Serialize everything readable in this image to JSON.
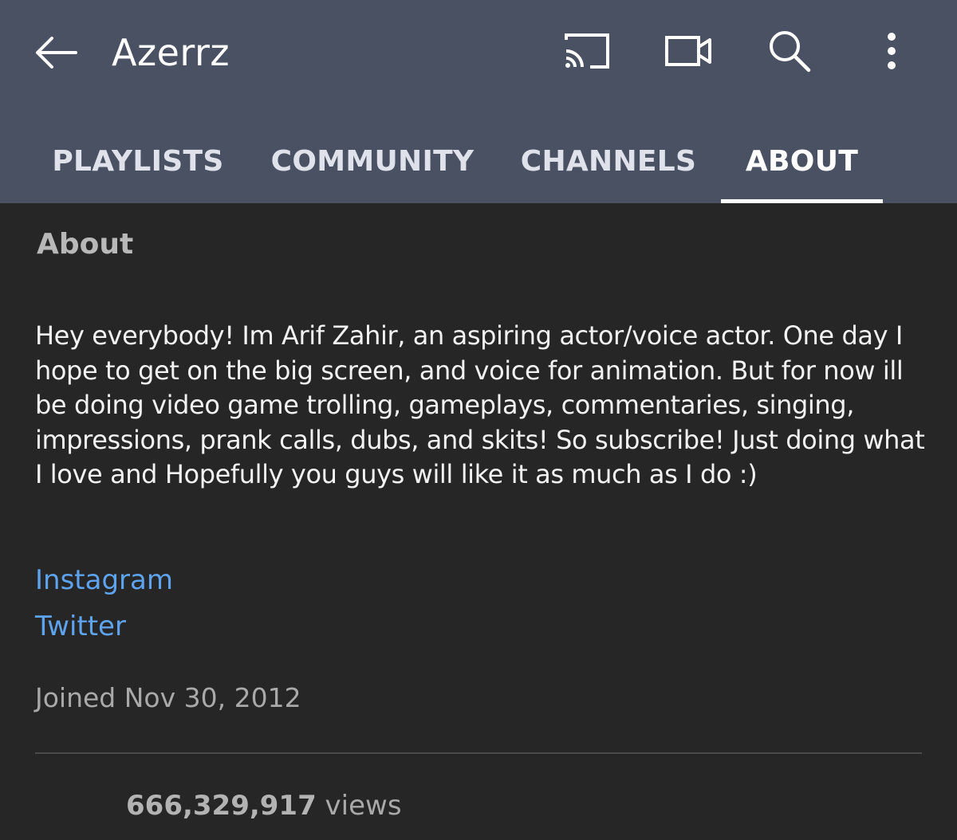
{
  "header": {
    "title": "Azerrz",
    "icons": {
      "back": "arrow-left-icon",
      "cast": "cast-icon",
      "camera": "video-camera-icon",
      "search": "search-icon",
      "more": "more-vertical-icon"
    }
  },
  "tabs": [
    {
      "label": "PLAYLISTS",
      "active": false
    },
    {
      "label": "COMMUNITY",
      "active": false
    },
    {
      "label": "CHANNELS",
      "active": false
    },
    {
      "label": "ABOUT",
      "active": true
    }
  ],
  "about": {
    "heading": "About",
    "description": "Hey everybody! Im Arif Zahir, an aspiring actor/voice actor. One day I hope to get on the big screen, and voice for animation. But for now ill be doing video game trolling, gameplays, commentaries, singing, impressions, prank calls, dubs, and skits! So subscribe! Just doing what I love and Hopefully you guys will like it as much as I do :)",
    "links": [
      {
        "label": "Instagram"
      },
      {
        "label": "Twitter"
      }
    ],
    "joined": "Joined Nov 30, 2012",
    "views_count": "666,329,917",
    "views_suffix": " views"
  },
  "colors": {
    "appbar": "#495163",
    "background": "#262626",
    "link": "#5ea3ee"
  }
}
